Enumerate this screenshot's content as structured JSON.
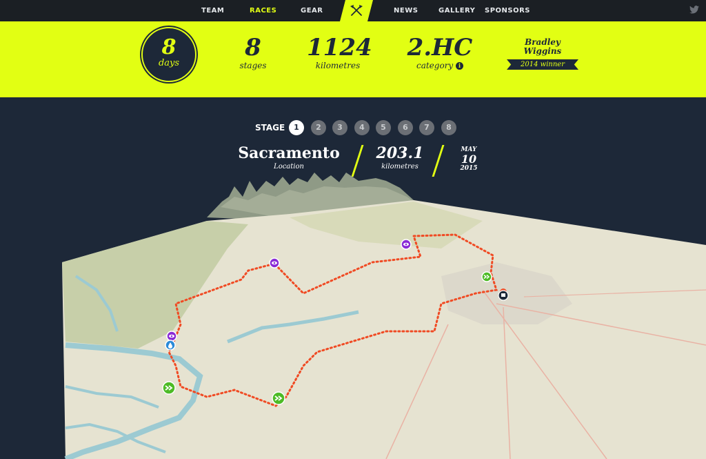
{
  "nav": {
    "items": [
      {
        "label": "TEAM",
        "active": false
      },
      {
        "label": "RACES",
        "active": true
      },
      {
        "label": "GEAR",
        "active": false
      },
      {
        "label": "NEWS",
        "active": false
      },
      {
        "label": "GALLERY",
        "active": false
      },
      {
        "label": "SPONSORS",
        "active": false
      }
    ],
    "logo_icon": "crossed-axes-icon",
    "social_icon": "twitter-icon"
  },
  "stats": {
    "days": {
      "value": "8",
      "label": "days"
    },
    "stages": {
      "value": "8",
      "label": "stages"
    },
    "kilometres": {
      "value": "1124",
      "label": "kilometres"
    },
    "category": {
      "value": "2.HC",
      "label": "category",
      "info_icon": "i"
    },
    "winner": {
      "name": "Bradley Wiggins",
      "ribbon": "2014 winner"
    }
  },
  "stage_selector": {
    "label": "STAGE",
    "stages": [
      "1",
      "2",
      "3",
      "4",
      "5",
      "6",
      "7",
      "8"
    ],
    "active": "1"
  },
  "stage_info": {
    "location": "Sacramento",
    "location_label": "Location",
    "distance": "203.1",
    "distance_label": "kilometres",
    "date_month": "MAY",
    "date_day": "10",
    "date_year": "2015"
  },
  "map_markers": [
    {
      "type": "viewpoint",
      "icon": "eye-icon"
    },
    {
      "type": "water",
      "icon": "water-drop-icon"
    },
    {
      "type": "sprint",
      "icon": "double-chevron-icon"
    },
    {
      "type": "start-finish",
      "icon": "flag-icon"
    }
  ],
  "colors": {
    "accent": "#e2ff13",
    "dark": "#1d2838",
    "route": "#f04a23",
    "marker_purple": "#8a2bd6",
    "marker_green": "#4dbb26",
    "marker_blue": "#2a8ad8"
  }
}
